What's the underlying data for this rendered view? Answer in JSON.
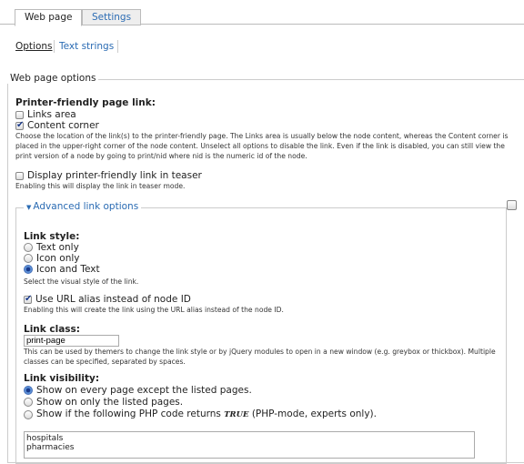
{
  "tabs": [
    {
      "label": "Web page",
      "active": true
    },
    {
      "label": "Settings",
      "active": false
    }
  ],
  "subtabs": [
    {
      "label": "Options",
      "active": true
    },
    {
      "label": "Text strings",
      "active": false
    }
  ],
  "web_page_options": {
    "legend": "Web page options",
    "printer_link": {
      "label": "Printer-friendly page link:",
      "options": [
        {
          "label": "Links area",
          "checked": false
        },
        {
          "label": "Content corner",
          "checked": true
        }
      ],
      "description_lines": [
        "Choose the location of the link(s) to the printer-friendly page. The Links area is usually below the node content, whereas the Content corner is",
        "placed in the upper-right corner of the node content. Unselect all options to disable the link. Even if the link is disabled, you can still view the",
        "print version of a node by going to print/nid where nid is the numeric id of the node."
      ]
    },
    "teaser": {
      "label": "Display printer-friendly link in teaser",
      "checked": false,
      "description": "Enabling this will display the link in teaser mode."
    }
  },
  "advanced": {
    "legend": "Advanced link options",
    "link_style": {
      "label": "Link style:",
      "options": [
        {
          "label": "Text only",
          "selected": false
        },
        {
          "label": "Icon only",
          "selected": false
        },
        {
          "label": "Icon and Text",
          "selected": true
        }
      ],
      "description": "Select the visual style of the link."
    },
    "url_alias": {
      "label": "Use URL alias instead of node ID",
      "checked": true,
      "description": "Enabling this will create the link using the URL alias instead of the node ID."
    },
    "link_class": {
      "label": "Link class:",
      "value": "print-page",
      "description_lines": [
        "This can be used by themers to change the link style or by jQuery modules to open in a new window (e.g. greybox or thickbox). Multiple",
        "classes can be specified, separated by spaces."
      ]
    },
    "visibility": {
      "label": "Link visibility:",
      "options": [
        {
          "label": "Show on every page except the listed pages.",
          "selected": true
        },
        {
          "label": "Show on only the listed pages.",
          "selected": false
        },
        {
          "label_before": "Show if the following PHP code returns ",
          "label_code": "TRUE",
          "label_after": " (PHP-mode, experts only).",
          "selected": false
        }
      ],
      "pages_lines": [
        "hospitals",
        "pharmacies"
      ]
    }
  }
}
